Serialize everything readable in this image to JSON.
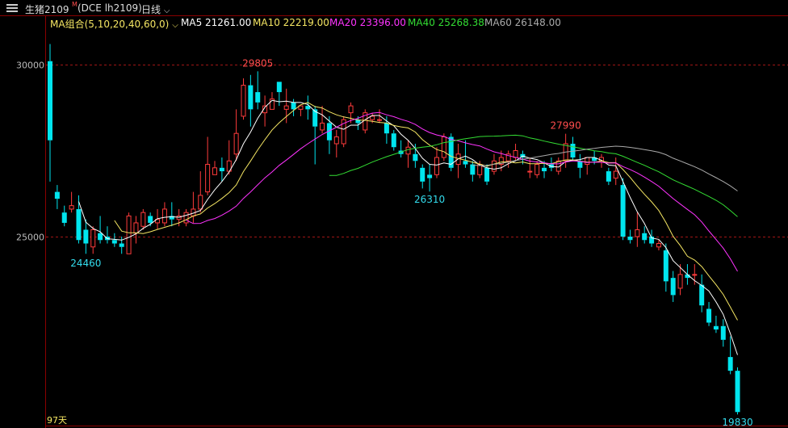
{
  "header": {
    "instrument": "生猪2109",
    "superscript": "M",
    "code": "(DCE lh2109)",
    "period": "日线",
    "ma_group": "MA组合(5,10,20,40,60,0)"
  },
  "ma_legend": [
    {
      "label": "MA5 21261.00",
      "color": "#ffffff"
    },
    {
      "label": "MA10 22219.00",
      "color": "#f5e663"
    },
    {
      "label": "MA20 23396.00",
      "color": "#ff33ff"
    },
    {
      "label": "MA40 25268.38",
      "color": "#33dd33"
    },
    {
      "label": "MA60 26148.00",
      "color": "#aaaaaa"
    }
  ],
  "chart_data": {
    "type": "candlestick",
    "y_ticks": [
      30000,
      25000
    ],
    "ylim": [
      19700,
      31300
    ],
    "days_label": "97天",
    "colors": {
      "up": "#ff3b3b",
      "down": "#00e5ee"
    },
    "series_ohlc": [
      [
        30100,
        30600,
        26600,
        27800
      ],
      [
        26300,
        26500,
        25800,
        26100
      ],
      [
        25700,
        25900,
        25300,
        25400
      ],
      [
        25800,
        26300,
        25700,
        25900
      ],
      [
        25800,
        26200,
        24800,
        24900
      ],
      [
        25200,
        25500,
        24500,
        24800
      ],
      [
        24700,
        25300,
        24500,
        25200
      ],
      [
        25100,
        25600,
        24800,
        24900
      ],
      [
        25000,
        25300,
        24800,
        24900
      ],
      [
        24900,
        25100,
        24700,
        24800
      ],
      [
        24800,
        25000,
        24500,
        24700
      ],
      [
        24500,
        25700,
        24500,
        25600
      ],
      [
        25100,
        25600,
        24800,
        25400
      ],
      [
        25300,
        25800,
        25200,
        25700
      ],
      [
        25600,
        25700,
        25300,
        25400
      ],
      [
        25400,
        25800,
        25200,
        25500
      ],
      [
        25400,
        26000,
        25300,
        25800
      ],
      [
        25600,
        26000,
        25300,
        25500
      ],
      [
        25500,
        25800,
        25300,
        25600
      ],
      [
        25400,
        25800,
        25300,
        25700
      ],
      [
        25600,
        26300,
        25400,
        25800
      ],
      [
        25800,
        26900,
        25700,
        26200
      ],
      [
        26300,
        27900,
        26200,
        27100
      ],
      [
        26800,
        27200,
        26900,
        27000
      ],
      [
        27000,
        27300,
        26600,
        26900
      ],
      [
        26900,
        27800,
        26800,
        27200
      ],
      [
        27400,
        28700,
        27200,
        28000
      ],
      [
        28500,
        29600,
        28400,
        29400
      ],
      [
        29400,
        29700,
        28200,
        28700
      ],
      [
        29200,
        29805,
        28700,
        28900
      ],
      [
        28600,
        29100,
        28200,
        28800
      ],
      [
        28700,
        29200,
        28700,
        29000
      ],
      [
        29500,
        29500,
        28800,
        29200
      ],
      [
        28700,
        29300,
        28300,
        28800
      ],
      [
        28900,
        29000,
        28500,
        28700
      ],
      [
        28700,
        28800,
        28500,
        28800
      ],
      [
        28800,
        29100,
        28400,
        28700
      ],
      [
        28700,
        28800,
        27100,
        28200
      ],
      [
        28100,
        28800,
        28000,
        28300
      ],
      [
        28300,
        28500,
        27400,
        27800
      ],
      [
        27700,
        28100,
        27300,
        27900
      ],
      [
        27700,
        28500,
        27600,
        28400
      ],
      [
        28600,
        28900,
        28300,
        28800
      ],
      [
        28400,
        28500,
        28100,
        28300
      ],
      [
        28100,
        28700,
        28000,
        28600
      ],
      [
        28400,
        28600,
        28300,
        28500
      ],
      [
        28400,
        28700,
        28300,
        28400
      ],
      [
        28300,
        28500,
        27700,
        28000
      ],
      [
        28000,
        28100,
        27500,
        27600
      ],
      [
        27500,
        27800,
        27300,
        27400
      ],
      [
        27400,
        27800,
        27000,
        27600
      ],
      [
        27400,
        27700,
        27000,
        27200
      ],
      [
        27000,
        27100,
        26400,
        26600
      ],
      [
        26800,
        27100,
        26310,
        26700
      ],
      [
        26800,
        27600,
        26700,
        27300
      ],
      [
        27300,
        28000,
        27200,
        27900
      ],
      [
        27900,
        28000,
        26900,
        27000
      ],
      [
        27100,
        27700,
        26700,
        27400
      ],
      [
        27200,
        27800,
        27000,
        27100
      ],
      [
        27100,
        27200,
        26600,
        26800
      ],
      [
        26800,
        27200,
        26700,
        27100
      ],
      [
        27000,
        27100,
        26500,
        26600
      ],
      [
        26900,
        27400,
        26800,
        27200
      ],
      [
        27100,
        27500,
        26900,
        27300
      ],
      [
        27200,
        27500,
        27000,
        27400
      ],
      [
        27300,
        27700,
        27200,
        27500
      ],
      [
        27400,
        27500,
        27100,
        27300
      ],
      [
        26900,
        27300,
        26700,
        26900
      ],
      [
        26800,
        27200,
        26700,
        27100
      ],
      [
        27000,
        27200,
        26700,
        26900
      ],
      [
        27100,
        27300,
        26900,
        27000
      ],
      [
        26900,
        27300,
        26800,
        27200
      ],
      [
        27200,
        27990,
        27000,
        27700
      ],
      [
        27700,
        27900,
        27200,
        27300
      ],
      [
        27200,
        27400,
        26700,
        27000
      ],
      [
        27100,
        27300,
        26800,
        27300
      ],
      [
        27300,
        27500,
        27100,
        27200
      ],
      [
        27200,
        27400,
        27000,
        27300
      ],
      [
        26900,
        27000,
        26500,
        26600
      ],
      [
        26700,
        27300,
        26500,
        26900
      ],
      [
        26500,
        26700,
        24900,
        25000
      ],
      [
        25000,
        25200,
        24800,
        24900
      ],
      [
        25000,
        25700,
        24700,
        25200
      ],
      [
        25100,
        25300,
        24800,
        24900
      ],
      [
        25000,
        25200,
        24700,
        24800
      ],
      [
        24700,
        24900,
        24600,
        24800
      ],
      [
        24600,
        24800,
        23400,
        23700
      ],
      [
        23800,
        24000,
        23100,
        23300
      ],
      [
        23500,
        24200,
        23300,
        23900
      ],
      [
        23900,
        24200,
        23600,
        23800
      ],
      [
        23900,
        24200,
        23600,
        23900
      ],
      [
        23600,
        23900,
        22800,
        23000
      ],
      [
        22900,
        23100,
        22400,
        22500
      ],
      [
        22400,
        22700,
        22200,
        22300
      ],
      [
        22400,
        22600,
        21800,
        22000
      ],
      [
        21500,
        22100,
        21000,
        21100
      ],
      [
        21100,
        21200,
        19830,
        19900
      ]
    ]
  },
  "annotations": [
    {
      "text": "29805",
      "idx": 29,
      "value": 29805,
      "side": "above",
      "color": "#ff4d4d"
    },
    {
      "text": "24460",
      "idx": 5,
      "value": 24460,
      "side": "below",
      "color": "#33ddee"
    },
    {
      "text": "26310",
      "idx": 53,
      "value": 26310,
      "side": "below",
      "color": "#33ddee"
    },
    {
      "text": "27990",
      "idx": 72,
      "value": 27990,
      "side": "above",
      "color": "#ff4d4d"
    },
    {
      "text": "19830",
      "idx": 96,
      "value": 19830,
      "side": "below",
      "color": "#33ddee"
    }
  ]
}
